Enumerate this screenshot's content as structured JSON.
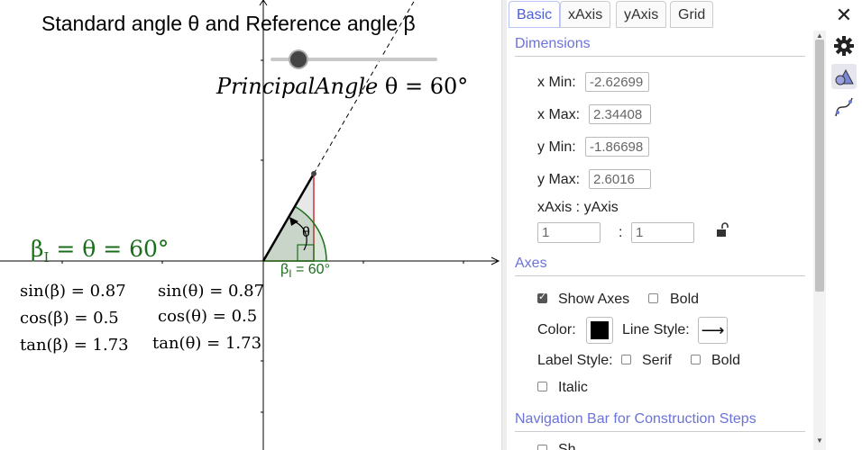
{
  "graphics": {
    "title": "Standard angle θ and Reference angle β",
    "principal_angle_prefix": "Principal",
    "principal_angle_word": "Angle",
    "principal_angle_eq": "θ = 60°",
    "beta_equation": "βI = θ = 60°",
    "beta_eq_beta": "β",
    "beta_eq_sub": "I",
    "beta_eq_rest": " = θ = 60°",
    "angle_label_beta": "β",
    "angle_label_sub": "I",
    "angle_label_rest": " = 60°",
    "theta_marker": "θ",
    "trig_beta": [
      "sin(β) = 0.87",
      "cos(β) = 0.5",
      "tan(β) = 1.73"
    ],
    "trig_theta": [
      "sin(θ) = 0.87",
      "cos(θ) = 0.5",
      "tan(θ) = 1.73"
    ],
    "slider_value_deg": 60,
    "colors": {
      "green": "#1a6e1a",
      "red": "#cc3333",
      "accent": "#4b5ed7"
    }
  },
  "panel": {
    "tabs": [
      "Basic",
      "xAxis",
      "yAxis",
      "Grid"
    ],
    "active_tab": "Basic",
    "dimensions": {
      "heading": "Dimensions",
      "xmin_label": "x Min:",
      "xmin_value": "-2.62699",
      "xmax_label": "x Max:",
      "xmax_value": "2.34408",
      "ymin_label": "y Min:",
      "ymin_value": "-1.86698",
      "ymax_label": "y Max:",
      "ymax_value": "2.6016",
      "ratio_label": "xAxis : yAxis",
      "ratio_x": "1",
      "ratio_sep": ":",
      "ratio_y": "1"
    },
    "axes": {
      "heading": "Axes",
      "show_axes_label": "Show Axes",
      "show_axes_checked": true,
      "bold_label": "Bold",
      "bold_checked": false,
      "color_label": "Color:",
      "color_value": "#000000",
      "line_style_label": "Line Style:",
      "line_style_glyph": "⟶",
      "label_style_label": "Label Style:",
      "serif_label": "Serif",
      "serif_checked": false,
      "bold2_label": "Bold",
      "bold2_checked": false,
      "italic_label": "Italic",
      "italic_checked": false
    },
    "nav_heading": "Navigation Bar for Construction Steps",
    "nav_partial": "Sh"
  },
  "rail": {
    "close_icon": "✕",
    "items": [
      "gear-icon",
      "graphics-view-icon",
      "graphics2-view-icon"
    ]
  }
}
